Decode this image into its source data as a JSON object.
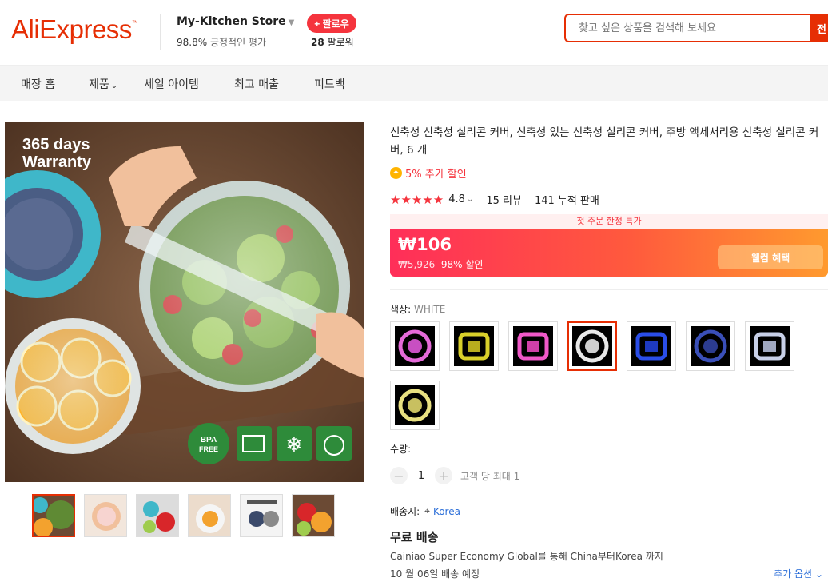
{
  "header": {
    "logo": "AliExpress",
    "store_name": "My-Kitchen Store",
    "store_rating_pct": "98.8%",
    "store_rating_text": "긍정적인 평가",
    "follow_label": "+ 팔로우",
    "followers_count": "28",
    "followers_text": "팔로워",
    "search_placeholder": "찾고 싶은 상품을 검색해 보세요",
    "search_button": "전"
  },
  "nav": {
    "items": [
      {
        "label": "매장 홈"
      },
      {
        "label": "제품"
      },
      {
        "label": "세일 아이템"
      },
      {
        "label": "최고 매출"
      },
      {
        "label": "피드백"
      }
    ]
  },
  "gallery": {
    "overlay_text_1": "365 days",
    "overlay_text_2": "Warranty",
    "badge_bpa": "BPA FREE",
    "thumbnail_count": 6
  },
  "product": {
    "title": "신축성 신축성 실리콘 커버, 신축성 있는 신축성 실리콘 커버, 주방 액세서리용 신축성 실리콘 커버, 6 개",
    "coupon_text": "5% 추가 할인",
    "rating_value": "4.8",
    "rating_stars": 4.8,
    "reviews": "15 리뷰",
    "sold": "141 누적 판매",
    "deal_banner": "첫 주문 한정 특가",
    "price": "₩106",
    "old_price": "₩5,926",
    "discount": "98% 할인",
    "welcome_label": "웰컴 혜택",
    "color_label": "색상:",
    "color_value": "WHITE",
    "colors": [
      "pink",
      "yellow",
      "magenta",
      "white",
      "blue",
      "navy",
      "clear",
      "lime"
    ],
    "selected_color_index": 3,
    "qty_label": "수량:",
    "qty_minus": "−",
    "qty_value": "1",
    "qty_plus": "+",
    "qty_limit": "고객 당 최대 1",
    "ship_to_label": "배송지:",
    "ship_to_value": "Korea",
    "free_shipping": "무료 배송",
    "shipping_desc": "Cainiao Super Economy Global를 통해 China부터Korea 까지",
    "eta": "10 월 06일 배송 예정",
    "more_options": "추가 옵션"
  },
  "colors": {
    "brand": "#e62e04",
    "accent": "#f5343d",
    "link": "#2b6ed8"
  }
}
